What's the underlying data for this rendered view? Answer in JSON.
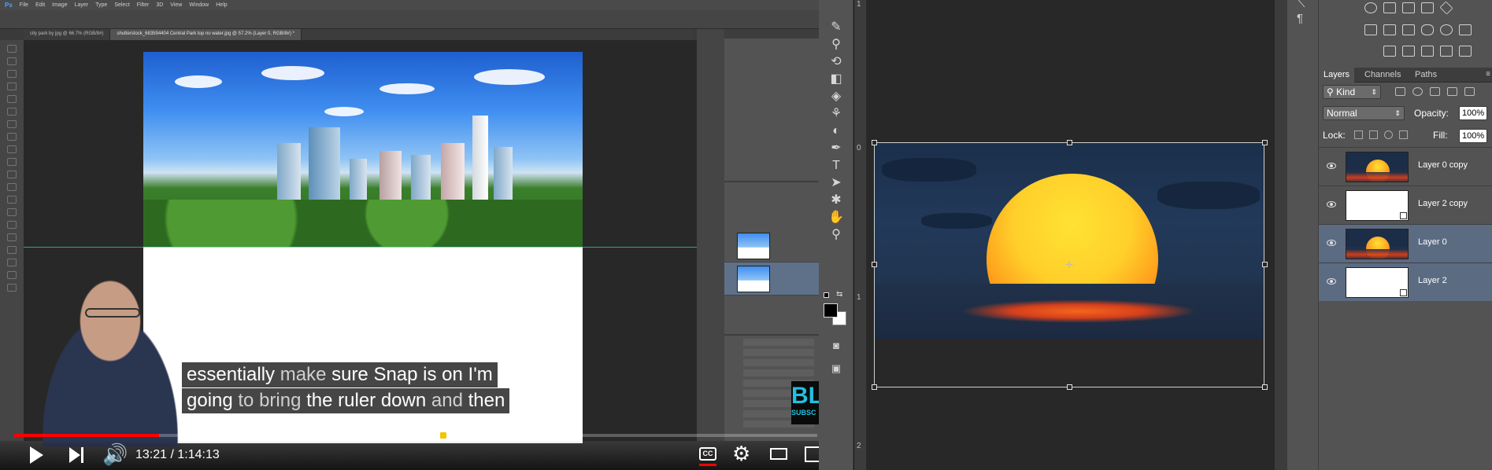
{
  "video": {
    "ps_menu": [
      "File",
      "Edit",
      "Image",
      "Layer",
      "Type",
      "Select",
      "Filter",
      "3D",
      "View",
      "Window",
      "Help"
    ],
    "doc_tabs": [
      "city park by jpg @ 66.7% (RGB/8#)",
      "shutterstock_683594404 Central Park top no water.jpg @ 57.2% (Layer 0, RGB/8#) *"
    ],
    "caption_line1_parts": [
      {
        "text": "essentially ",
        "dim": false
      },
      {
        "text": "make ",
        "dim": true
      },
      {
        "text": "sure Snap is on I'm",
        "dim": false
      }
    ],
    "caption_line2_parts": [
      {
        "text": "going ",
        "dim": false
      },
      {
        "text": "to ",
        "dim": true
      },
      {
        "text": "bring ",
        "dim": true
      },
      {
        "text": "the ruler down ",
        "dim": false
      },
      {
        "text": "and ",
        "dim": true
      },
      {
        "text": "then",
        "dim": false
      }
    ],
    "time_display": "13:21 / 1:14:13",
    "progress_fraction": 0.18,
    "marker_fraction": 0.53,
    "cc_label": "CC",
    "subscribe_big": "BL",
    "subscribe_small": "SUBSC"
  },
  "toolstrip": {
    "tools": [
      "brush-icon",
      "clone-stamp-icon",
      "history-brush-icon",
      "eraser-icon",
      "paint-bucket-icon",
      "smudge-icon",
      "dodge-icon",
      "pen-icon",
      "type-icon",
      "path-selection-icon",
      "custom-shape-icon",
      "hand-icon",
      "zoom-icon"
    ],
    "tool_glyphs": [
      "✎",
      "⚲",
      "⟲",
      "◧",
      "◈",
      "⚘",
      "◐",
      "✒",
      "T",
      "➤",
      "✱",
      "✋",
      "⚲"
    ]
  },
  "canvas": {
    "ruler_labels": [
      "1",
      "0",
      "1",
      "2"
    ]
  },
  "panel": {
    "tabs": [
      "Layers",
      "Channels",
      "Paths"
    ],
    "filter_kind": "Kind",
    "blend_mode": "Normal",
    "opacity_label": "Opacity:",
    "opacity_value": "100%",
    "lock_label": "Lock:",
    "fill_label": "Fill:",
    "fill_value": "100%",
    "layers": [
      {
        "name": "Layer 0 copy",
        "thumb": "sunset",
        "smart": false,
        "selected": false
      },
      {
        "name": "Layer 2 copy",
        "thumb": "blank",
        "smart": true,
        "selected": false
      },
      {
        "name": "Layer 0",
        "thumb": "sunset",
        "smart": false,
        "selected": true
      },
      {
        "name": "Layer 2",
        "thumb": "blank",
        "smart": true,
        "selected": true
      }
    ]
  }
}
